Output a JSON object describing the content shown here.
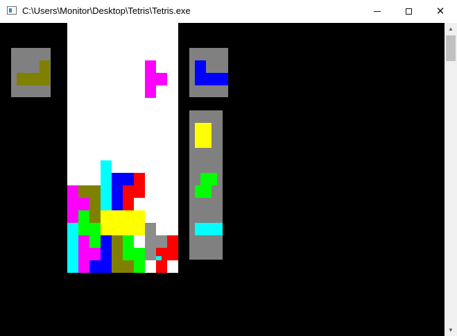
{
  "window": {
    "title": "C:\\Users\\Monitor\\Desktop\\Tetris\\Tetris.exe"
  },
  "icons": {
    "app": "console-app-icon",
    "minimize": "minimize-icon",
    "maximize": "maximize-icon",
    "close": "close-icon",
    "scroll_up": "scroll-up-arrow-icon",
    "scroll_down": "scroll-down-arrow-icon"
  },
  "colors": {
    "background": "#000000",
    "board": "#ffffff",
    "panel": "#808080",
    "magenta": "#ff00ff",
    "olive": "#808000",
    "cyan": "#00ffff",
    "blue": "#0000ff",
    "red": "#ff0000",
    "green": "#00ff00",
    "yellow": "#ffff00",
    "gray": "#8c8c8c"
  },
  "game": {
    "hold_piece": {
      "type": "L",
      "color": "olive"
    },
    "next_piece": {
      "type": "J",
      "color": "blue"
    },
    "queue": [
      {
        "type": "O",
        "color": "yellow"
      },
      {
        "type": "S",
        "color": "green"
      },
      {
        "type": "I",
        "color": "cyan"
      }
    ],
    "falling_piece": {
      "type": "T",
      "color": "magenta"
    }
  }
}
